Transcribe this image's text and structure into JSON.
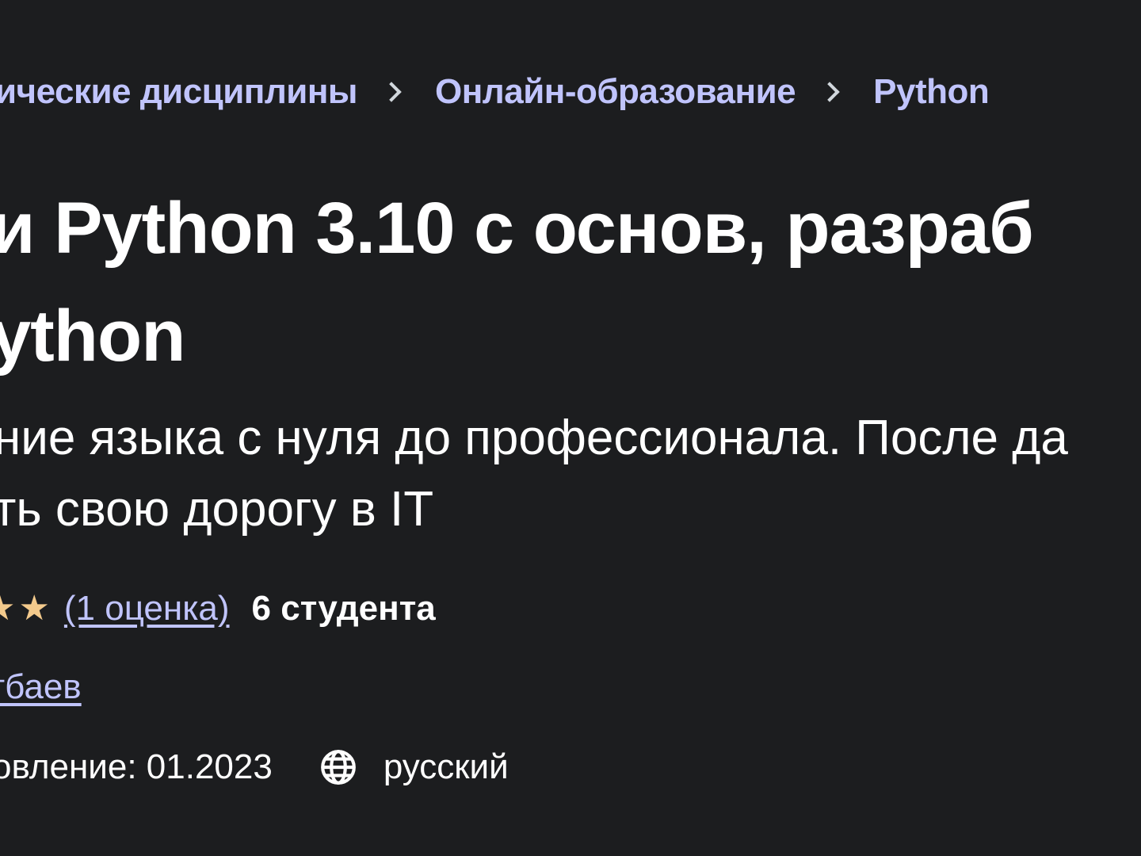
{
  "breadcrumb": [
    {
      "label": "ические дисциплины"
    },
    {
      "label": "Онлайн-образование"
    },
    {
      "label": "Python"
    }
  ],
  "title": {
    "line1": "и Python 3.10 с основ, разраб",
    "line2": "ython"
  },
  "subtitle": {
    "line1": "ние языка с нуля до профессионала. После да",
    "line2": "ть свою дорогу в IT"
  },
  "rating": {
    "stars_visible": 2,
    "star_color": "#f3ca8c",
    "reviews_label": "(1 оценка)",
    "students_label": "6 студента"
  },
  "author": {
    "name": "тбаев"
  },
  "meta": {
    "updated_label": "овление: 01.2023",
    "language_icon": "globe-icon",
    "language": "русский"
  },
  "colors": {
    "background": "#1c1d1f",
    "link": "#c0c4fc",
    "text": "#ffffff"
  }
}
